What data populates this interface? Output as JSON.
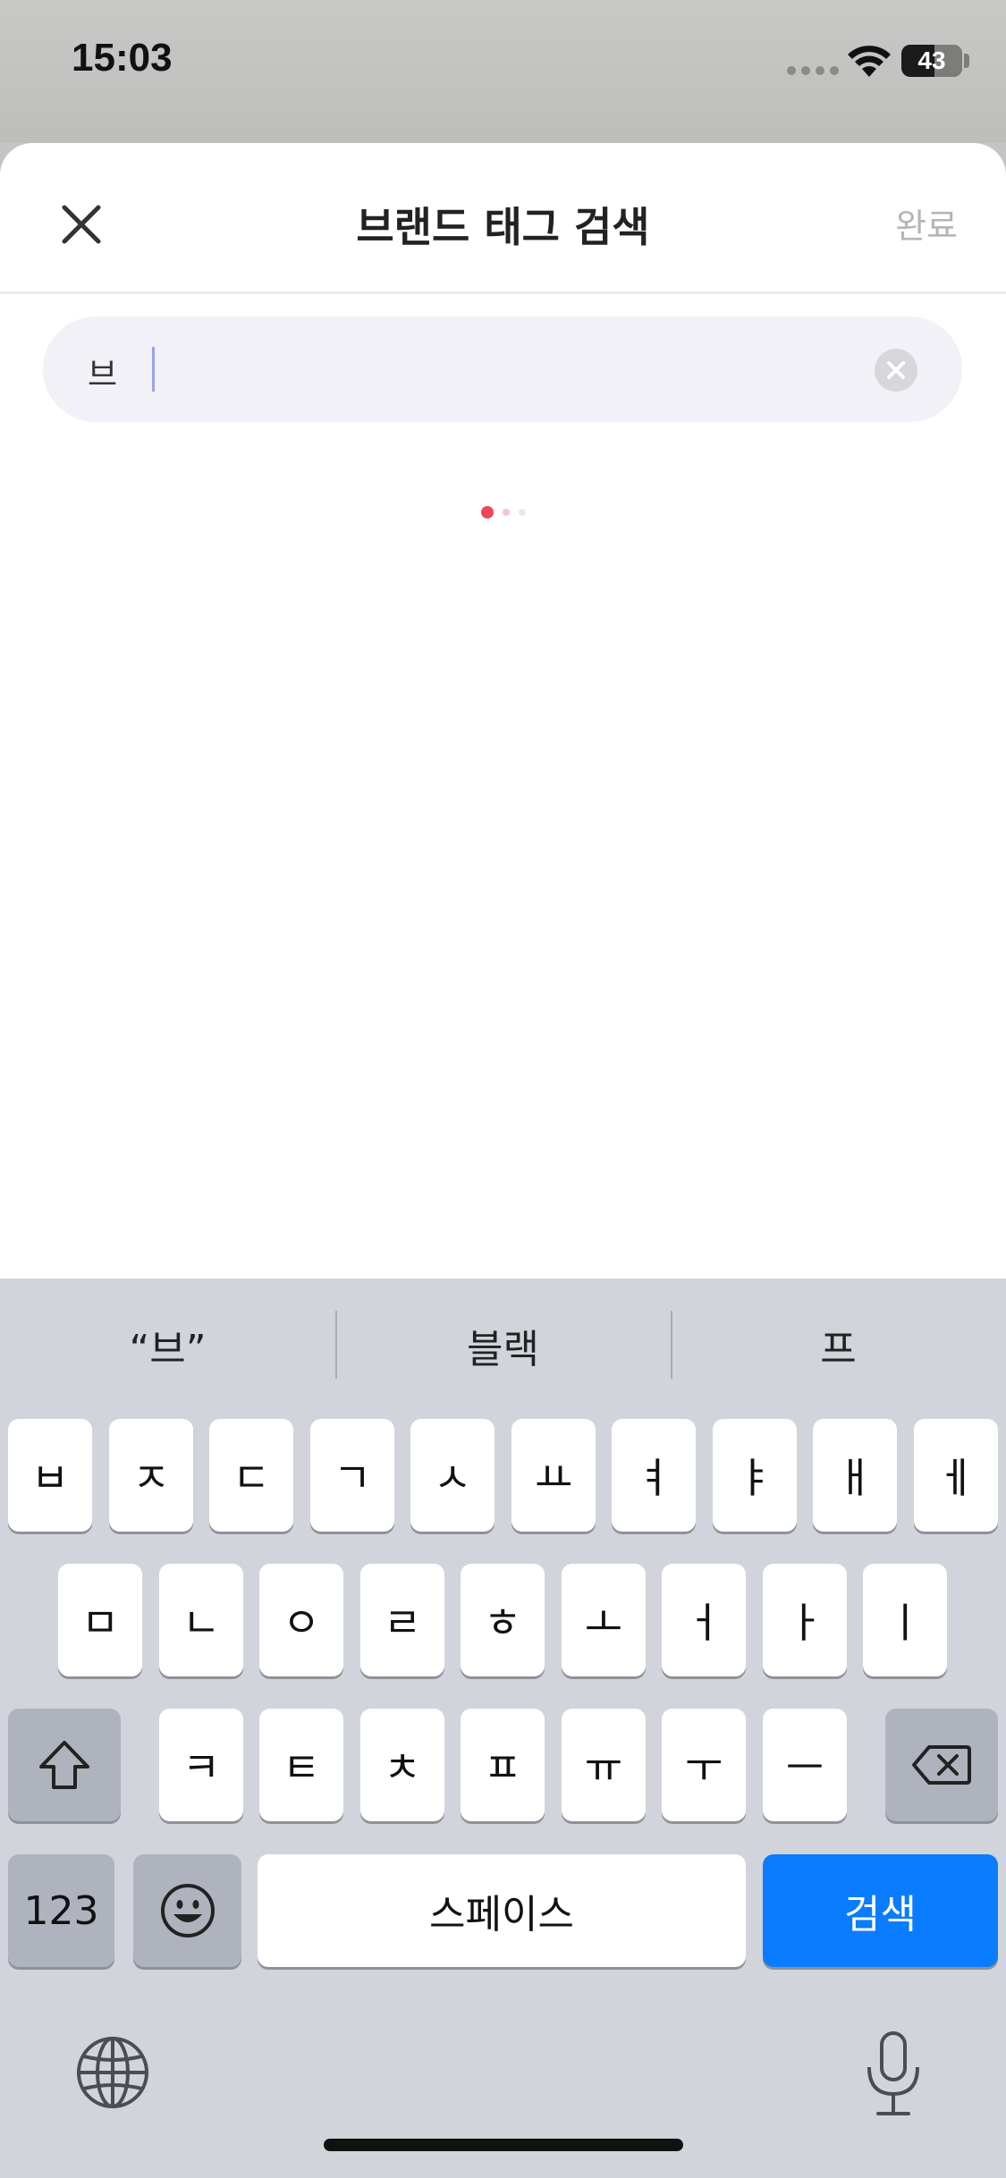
{
  "status_bar": {
    "time": "15:03",
    "battery": "43"
  },
  "header": {
    "title": "브랜드 태그 검색",
    "done_label": "완료",
    "close_icon": "close-icon"
  },
  "search": {
    "value": "브",
    "clear_icon": "clear-icon"
  },
  "loading": {
    "colors": [
      "#f0455a",
      "#f6c4cb",
      "#efe6e8"
    ]
  },
  "keyboard": {
    "suggestions": [
      "“브”",
      "블랙",
      "프"
    ],
    "row1": [
      "ㅂ",
      "ㅈ",
      "ㄷ",
      "ㄱ",
      "ㅅ",
      "ㅛ",
      "ㅕ",
      "ㅑ",
      "ㅐ",
      "ㅔ"
    ],
    "row2": [
      "ㅁ",
      "ㄴ",
      "ㅇ",
      "ㄹ",
      "ㅎ",
      "ㅗ",
      "ㅓ",
      "ㅏ",
      "ㅣ"
    ],
    "row3": [
      "ㅋ",
      "ㅌ",
      "ㅊ",
      "ㅍ",
      "ㅠ",
      "ㅜ",
      "ㅡ"
    ],
    "numbers_label": "123",
    "space_label": "스페이스",
    "search_label": "검색",
    "accent_color": "#0a7cff"
  }
}
